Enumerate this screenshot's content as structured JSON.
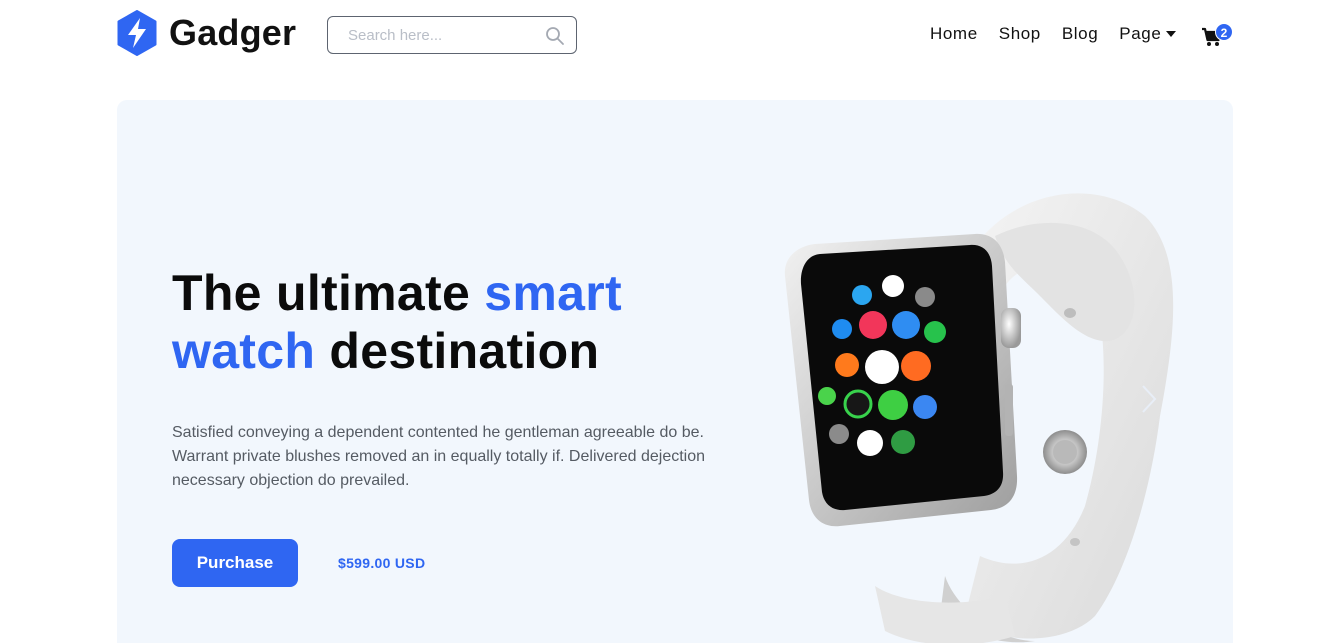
{
  "brand": {
    "name": "Gadger",
    "logo_icon": "lightning-hexagon-icon",
    "color": "#2f66f2"
  },
  "search": {
    "placeholder": "Search here...",
    "value": "",
    "icon": "search-icon"
  },
  "nav": {
    "items": [
      {
        "label": "Home"
      },
      {
        "label": "Shop"
      },
      {
        "label": "Blog"
      },
      {
        "label": "Page",
        "has_dropdown": true
      }
    ],
    "cart": {
      "icon": "cart-icon",
      "count": "2"
    }
  },
  "hero": {
    "headline": {
      "part1": "The ultimate ",
      "accent1": "smart",
      "accent2": "watch",
      "part2": " destination"
    },
    "description": "Satisfied conveying a dependent contented he gentleman agreeable do be. Warrant private blushes removed an in equally totally if. Delivered dejection necessary objection do prevailed.",
    "purchase_label": "Purchase",
    "price": "$599.00 USD",
    "image": "smart-watch-image",
    "next_icon": "chevron-right-icon"
  },
  "colors": {
    "accent": "#2f66f2",
    "hero_bg": "#f2f7fd",
    "text": "#0b0b0b",
    "muted": "#555b63"
  }
}
